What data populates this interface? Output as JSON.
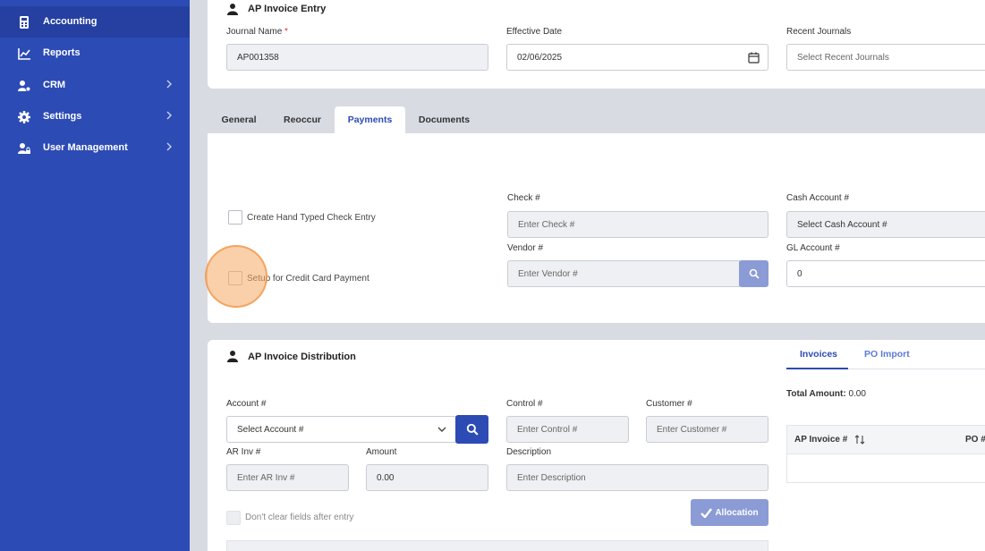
{
  "sidebar": {
    "items": [
      {
        "label": "Accounting",
        "icon": "calculator-icon",
        "active": true
      },
      {
        "label": "Reports",
        "icon": "chart-line-icon"
      },
      {
        "label": "CRM",
        "icon": "users-cog-icon",
        "has_children": true
      },
      {
        "label": "Settings",
        "icon": "gear-icon",
        "has_children": true
      },
      {
        "label": "User Management",
        "icon": "user-lock-icon",
        "has_children": true
      }
    ]
  },
  "header_card": {
    "title": "AP Invoice Entry",
    "journal_name_label": "Journal Name",
    "required_mark": "*",
    "journal_name_value": "AP001358",
    "effective_date_label": "Effective Date",
    "effective_date_value": "02/06/2025",
    "recent_journals_label": "Recent Journals",
    "recent_journals_placeholder": "Select Recent Journals"
  },
  "tabs": [
    "General",
    "Reoccur",
    "Payments",
    "Documents"
  ],
  "active_tab": "Payments",
  "payments": {
    "hand_typed_label": "Create Hand Typed Check Entry",
    "credit_card_label": "Setup for Credit Card Payment",
    "check_label": "Check #",
    "check_placeholder": "Enter Check #",
    "vendor_label": "Vendor #",
    "vendor_placeholder": "Enter Vendor #",
    "cash_account_label": "Cash Account #",
    "cash_account_placeholder": "Select Cash Account #",
    "gl_account_label": "GL Account #",
    "gl_account_value": "0"
  },
  "distribution": {
    "title": "AP Invoice Distribution",
    "account_label": "Account #",
    "account_placeholder": "Select Account #",
    "control_label": "Control #",
    "control_placeholder": "Enter Control #",
    "customer_label": "Customer #",
    "customer_placeholder": "Enter Customer #",
    "ar_inv_label": "AR Inv #",
    "ar_inv_placeholder": "Enter AR Inv #",
    "amount_label": "Amount",
    "amount_value": "0.00",
    "description_label": "Description",
    "description_placeholder": "Enter Description",
    "dont_clear_label": "Don't clear fields after entry",
    "allocation_label": "Allocation"
  },
  "right_panel": {
    "tabs": [
      "Invoices",
      "PO Import"
    ],
    "active_tab": "Invoices",
    "total_amount_label": "Total Amount:",
    "total_amount_value": "0.00",
    "columns": [
      "AP Invoice #",
      "PO #"
    ]
  },
  "colors": {
    "sidebar": "#2d4bb4",
    "accent": "#2d4bb4",
    "allocation_button": "#8b9bd6"
  }
}
